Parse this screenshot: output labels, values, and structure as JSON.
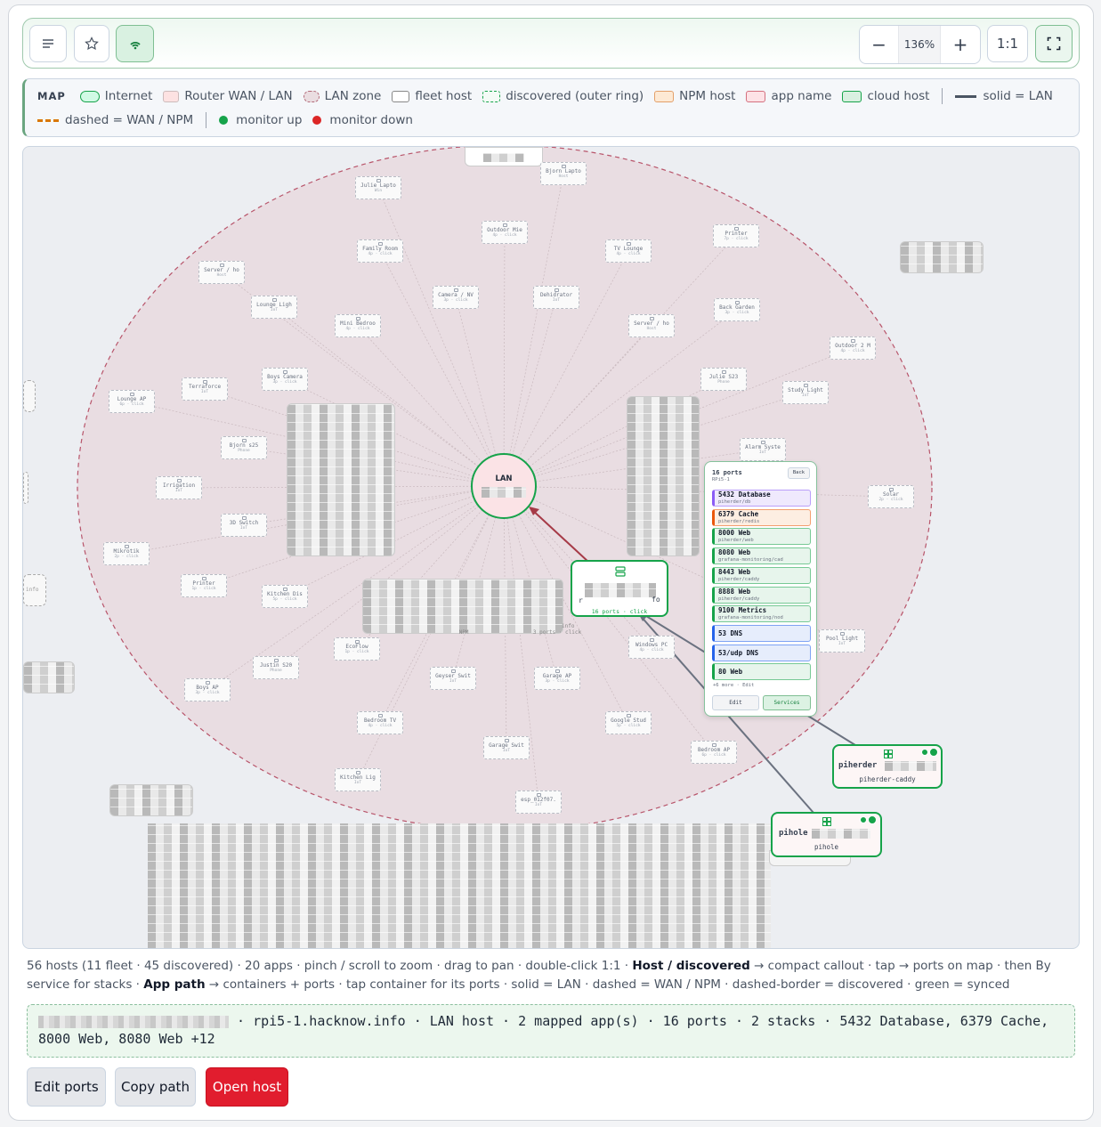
{
  "toolbar": {
    "zoom_value": "136%",
    "zoom_out_label": "−",
    "zoom_in_label": "+",
    "reset_label": "1:1"
  },
  "legend": {
    "title": "MAP",
    "items": {
      "internet": "Internet",
      "router": "Router WAN / LAN",
      "lan_zone": "LAN zone",
      "fleet": "fleet host",
      "discovered": "discovered (outer ring)",
      "npm": "NPM host",
      "app": "app name",
      "cloud": "cloud host",
      "solid": "solid = LAN",
      "dashed": "dashed = WAN / NPM",
      "up": "monitor up",
      "down": "monitor down"
    },
    "colors": {
      "internet": "#d1fae5",
      "router": "#fde2e2",
      "npm": "#fde9d4",
      "app": "#fde2e6",
      "cloud": "#d8f0e0",
      "up": "#16a34a",
      "down": "#dc2626",
      "dashed": "#d97706"
    }
  },
  "map": {
    "lan": {
      "label": "LAN"
    },
    "hosts": [
      {
        "name": "Julie Lapto",
        "sub": "Win"
      },
      {
        "name": "Bjorn Lapto",
        "sub": "Host"
      },
      {
        "name": "Outdoor Mie",
        "sub": "4p · click"
      },
      {
        "name": "Printer",
        "sub": "7p · click"
      },
      {
        "name": "Family Room",
        "sub": "4p · click"
      },
      {
        "name": "TV Lounge",
        "sub": "4p · click"
      },
      {
        "name": "Server / ho",
        "sub": "Host"
      },
      {
        "name": "Camera / NV",
        "sub": "3p · click"
      },
      {
        "name": "Dehidrator",
        "sub": "IoT"
      },
      {
        "name": "Back Garden",
        "sub": "3p · click"
      },
      {
        "name": "Lounge Ligh",
        "sub": "IoT"
      },
      {
        "name": "Mini Bedroo",
        "sub": "4p · click"
      },
      {
        "name": "Server / ho",
        "sub": "Host"
      },
      {
        "name": "Outdoor 2 M",
        "sub": "4p · click"
      },
      {
        "name": "Boys Camera",
        "sub": "3p · click"
      },
      {
        "name": "Julie S23",
        "sub": "Phone"
      },
      {
        "name": "Study Light",
        "sub": "IoT"
      },
      {
        "name": "Lounge AP",
        "sub": "6p · click"
      },
      {
        "name": "Terraforce",
        "sub": "IoT"
      },
      {
        "name": "Alarm Syste",
        "sub": "IoT"
      },
      {
        "name": "Bjorn s25",
        "sub": "Phone"
      },
      {
        "name": "Irrigation",
        "sub": "IoT"
      },
      {
        "name": "3D Switch",
        "sub": "IoT"
      },
      {
        "name": "Mikrotik",
        "sub": "2p · click"
      },
      {
        "name": "Printer",
        "sub": "1p · click"
      },
      {
        "name": "Kitchen Dis",
        "sub": "5p · click"
      },
      {
        "name": "EcoFlow",
        "sub": "1p · click"
      },
      {
        "name": "Windows PC",
        "sub": "4p · click"
      },
      {
        "name": "Justin S20",
        "sub": "Phone"
      },
      {
        "name": "Boys AP",
        "sub": "3p · click"
      },
      {
        "name": "Geyser Swit",
        "sub": "IoT"
      },
      {
        "name": "Garage AP",
        "sub": "3p · click"
      },
      {
        "name": "Bedroom TV",
        "sub": "4p · click"
      },
      {
        "name": "Google Stud",
        "sub": "5p · click"
      },
      {
        "name": "Garage Swit",
        "sub": "IoT"
      },
      {
        "name": "Bedroom AP",
        "sub": "6p · click"
      },
      {
        "name": "Kitchen Lig",
        "sub": "IoT"
      },
      {
        "name": "esp_012f07.",
        "sub": "IoT"
      },
      {
        "name": "Solar",
        "sub": "2p · click"
      },
      {
        "name": "Pool Light",
        "sub": "IoT"
      }
    ],
    "selected_host": {
      "ports_label": "16 ports · click",
      "left": "r",
      "right": "fo"
    },
    "misc": {
      "npm_label": "NPM",
      "ports3": "3 ports · click",
      "info": "info"
    },
    "port_card": {
      "title": "16 ports",
      "host": "RPi5-1",
      "back": "Back",
      "ports": [
        {
          "label": "5432 Database",
          "sub": "piherder/db",
          "color": "#8b5cf6",
          "bg": "#efe9fd"
        },
        {
          "label": "6379 Cache",
          "sub": "piherder/redis",
          "color": "#ea580c",
          "bg": "#fdeee2"
        },
        {
          "label": "8000 Web",
          "sub": "piherder/web",
          "color": "#16a34a",
          "bg": "#e7f5ec"
        },
        {
          "label": "8080 Web",
          "sub": "grafana-monitoring/cad",
          "color": "#16a34a",
          "bg": "#e7f5ec"
        },
        {
          "label": "8443 Web",
          "sub": "piherder/caddy",
          "color": "#16a34a",
          "bg": "#e7f5ec"
        },
        {
          "label": "8888 Web",
          "sub": "piherder/caddy",
          "color": "#16a34a",
          "bg": "#e7f5ec"
        },
        {
          "label": "9100 Metrics",
          "sub": "grafana-monitoring/nod",
          "color": "#16a34a",
          "bg": "#e7f5ec"
        },
        {
          "label": "53 DNS",
          "sub": "",
          "color": "#2563eb",
          "bg": "#e6edfc"
        },
        {
          "label": "53/udp DNS",
          "sub": "",
          "color": "#2563eb",
          "bg": "#e6edfc"
        },
        {
          "label": "80 Web",
          "sub": "",
          "color": "#16a34a",
          "bg": "#e7f5ec"
        }
      ],
      "more": "+6 more · Edit",
      "edit": "Edit",
      "services": "Services"
    },
    "apps": {
      "piherder": {
        "name": "piherder",
        "sub": "piherder-caddy"
      },
      "pihole": {
        "name": "pihole",
        "sub": "pihole"
      }
    }
  },
  "description": {
    "p1": "56 hosts (11 fleet · 45 discovered) · 20 apps · pinch / scroll to zoom · drag to pan · double-click 1:1 · ",
    "b1": "Host / discovered",
    "p2": " → compact callout · tap → ports on map · then By service for stacks · ",
    "b2": "App path",
    "p3": " → containers + ports · tap container for its ports · solid = LAN · dashed = WAN / NPM · dashed-border = discovered · green = synced"
  },
  "info_bar": {
    "text": " · rpi5-1.hacknow.info · LAN host · 2 mapped app(s) · 16 ports · 2 stacks · 5432 Database, 6379 Cache, 8000 Web, 8080 Web +12"
  },
  "actions": {
    "edit": "Edit ports",
    "copy": "Copy path",
    "open": "Open host"
  }
}
